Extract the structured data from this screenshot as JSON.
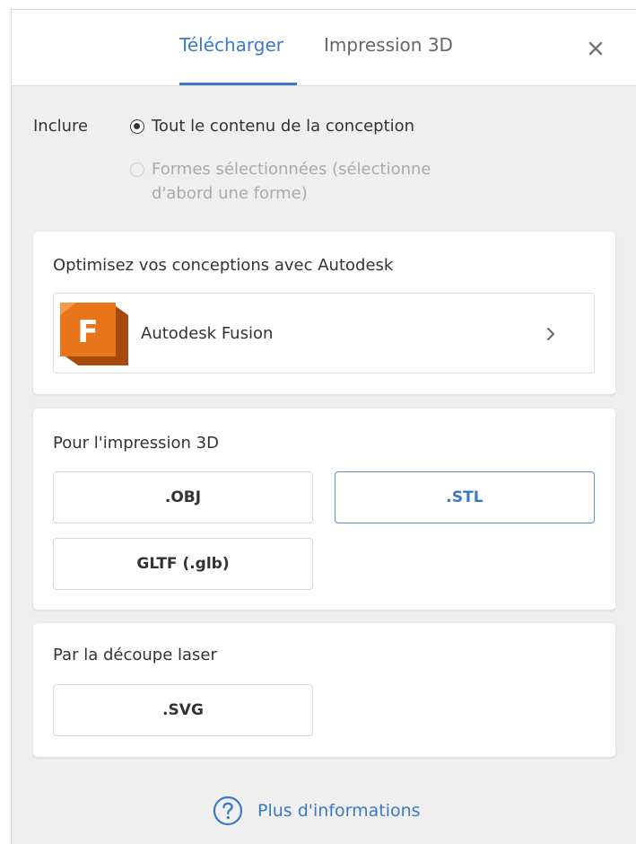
{
  "tabs": [
    {
      "label": "Télécharger",
      "active": true
    },
    {
      "label": "Impression 3D",
      "active": false
    }
  ],
  "header": {
    "close_icon": "close-icon"
  },
  "include": {
    "label": "Inclure",
    "options": [
      {
        "label": "Tout le contenu de la conception",
        "selected": true,
        "disabled": false
      },
      {
        "label": "Formes sélectionnées (sélectionne d'abord une forme)",
        "selected": false,
        "disabled": true
      }
    ]
  },
  "autodesk": {
    "title": "Optimisez vos conceptions avec Autodesk",
    "item_label": "Autodesk Fusion",
    "logo_letter": "F",
    "logo_icon": "autodesk-fusion-logo",
    "chevron_icon": "chevron-right-icon"
  },
  "print3d": {
    "title": "Pour l'impression 3D",
    "formats": [
      {
        "label": ".OBJ",
        "selected": false
      },
      {
        "label": ".STL",
        "selected": true
      },
      {
        "label": "GLTF (.glb)",
        "selected": false
      }
    ]
  },
  "laser": {
    "title": "Par la découpe laser",
    "formats": [
      {
        "label": ".SVG",
        "selected": false
      }
    ]
  },
  "footer": {
    "more_info": "Plus d'informations",
    "help_icon": "help-circle-icon"
  },
  "colors": {
    "accent": "#3a7ac4",
    "fusion_orange": "#e8751a",
    "fusion_dark": "#a84a10",
    "panel_bg": "#efefef"
  }
}
